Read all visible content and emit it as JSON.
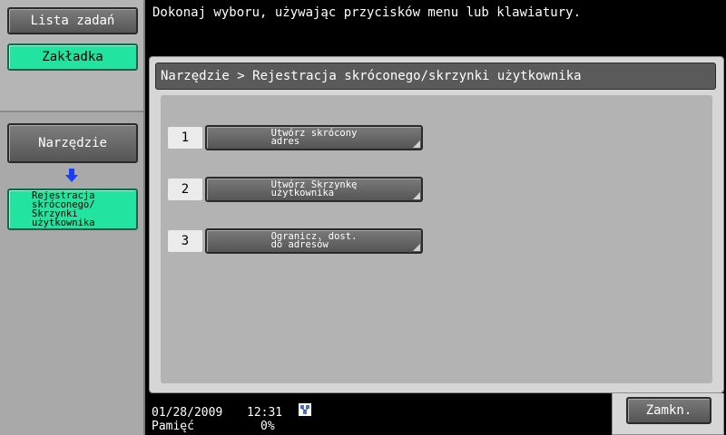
{
  "sidebar": {
    "job_list_label": "Lista zadań",
    "bookmark_label": "Zakładka",
    "tool_label": "Narzędzie",
    "current_item_lines": [
      "Rejestracja",
      "skróconego/",
      "Skrzynki",
      "użytkownika"
    ]
  },
  "header": {
    "message": "Dokonaj wyboru, używając przycisków menu lub klawiatury."
  },
  "main": {
    "breadcrumb": "Narzędzie > Rejestracja skróconego/skrzynki użytkownika",
    "items": [
      {
        "number": "1",
        "line1": "Utwórz skrócony",
        "line2": "adres"
      },
      {
        "number": "2",
        "line1": "Utwórz Skrzynkę",
        "line2": "użytkownika"
      },
      {
        "number": "3",
        "line1": "Ogranicz. dost.",
        "line2": "do adresów"
      }
    ]
  },
  "footer": {
    "date": "01/28/2009",
    "time": "12:31",
    "memory_label": "Pamięć",
    "memory_value": "0%",
    "close_label": "Zamkn."
  },
  "colors": {
    "accent_green": "#22e3a0",
    "arrow_blue": "#1a3cff"
  }
}
